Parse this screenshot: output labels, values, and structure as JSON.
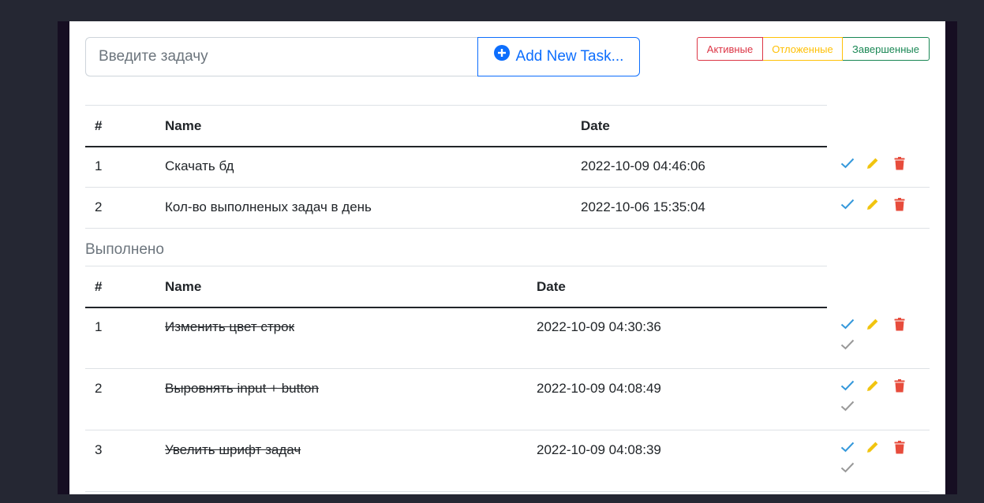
{
  "input": {
    "placeholder": "Введите задачу"
  },
  "add_button": {
    "label": "Add New Task..."
  },
  "filters": {
    "active": "Активные",
    "postponed": "Отложенные",
    "done": "Завершенные"
  },
  "active_table": {
    "headers": [
      "#",
      "Name",
      "Date"
    ],
    "rows": [
      {
        "num": "1",
        "name": "Скачать бд",
        "date": "2022-10-09 04:46:06"
      },
      {
        "num": "2",
        "name": "Кол-во выполненых задач в день",
        "date": "2022-10-06 15:35:04"
      }
    ]
  },
  "done_section": {
    "title": "Выполнено",
    "headers": [
      "#",
      "Name",
      "Date"
    ],
    "rows": [
      {
        "num": "1",
        "name": "Изменить цвет строк",
        "date": "2022-10-09 04:30:36"
      },
      {
        "num": "2",
        "name": "Выровнять input + button",
        "date": "2022-10-09 04:08:49"
      },
      {
        "num": "3",
        "name": "Увелить шрифт задач",
        "date": "2022-10-09 04:08:39"
      }
    ]
  },
  "icons": {
    "complete": "check-icon",
    "edit": "pencil-icon",
    "delete": "trash-icon",
    "undo": "check-icon-gray",
    "add": "plus-circle-icon"
  },
  "colors": {
    "primary": "#0d6efd",
    "danger": "#dc3545",
    "warning": "#ffc107",
    "success": "#198754",
    "check": "#3498db",
    "pencil": "#f1c40f",
    "trash": "#e74c3c",
    "muted": "#999999"
  }
}
